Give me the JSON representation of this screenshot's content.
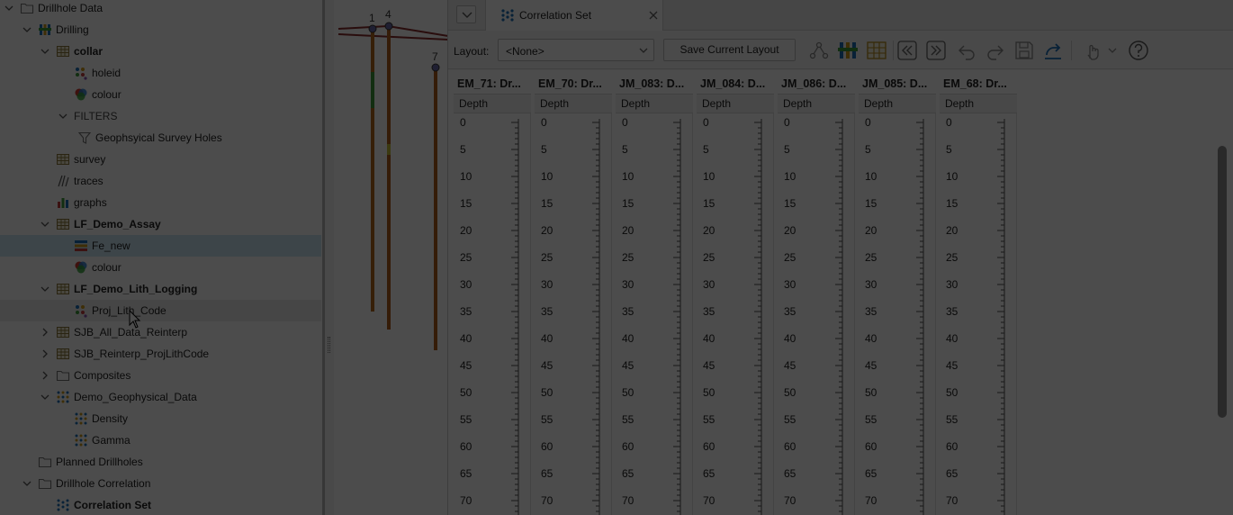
{
  "tree": {
    "rows": [
      {
        "label": "Drillhole Data",
        "expanded": true,
        "icon": "folder-icon",
        "bold": false
      },
      {
        "label": "Drilling",
        "expanded": true,
        "icon": "drillholes-icon",
        "bold": false
      },
      {
        "label": "collar",
        "expanded": true,
        "icon": "table-icon",
        "bold": true
      },
      {
        "label": "holeid",
        "expanded": null,
        "icon": "category-colour-icon",
        "bold": false
      },
      {
        "label": "colour",
        "expanded": null,
        "icon": "colour-icon",
        "bold": false
      },
      {
        "label": "FILTERS",
        "expanded": true,
        "icon": null,
        "bold": false
      },
      {
        "label": "Geophsyical Survey Holes",
        "expanded": null,
        "icon": "filter-icon",
        "bold": false
      },
      {
        "label": "survey",
        "expanded": null,
        "icon": "table-icon",
        "bold": false
      },
      {
        "label": "traces",
        "expanded": null,
        "icon": "traces-icon",
        "bold": false
      },
      {
        "label": "graphs",
        "expanded": null,
        "icon": "graphs-icon",
        "bold": false
      },
      {
        "label": "LF_Demo_Assay",
        "expanded": true,
        "icon": "table-icon",
        "bold": true
      },
      {
        "label": "Fe_new",
        "expanded": null,
        "icon": "numeric-colour-icon",
        "bold": false
      },
      {
        "label": "colour",
        "expanded": null,
        "icon": "colour-icon",
        "bold": false
      },
      {
        "label": "LF_Demo_Lith_Logging",
        "expanded": true,
        "icon": "table-icon",
        "bold": true
      },
      {
        "label": "Proj_Lith_Code",
        "expanded": null,
        "icon": "category-colour-icon",
        "bold": false
      },
      {
        "label": "SJB_All_Data_Reinterp",
        "expanded": false,
        "icon": "table-icon",
        "bold": false
      },
      {
        "label": "SJB_Reinterp_ProjLithCode",
        "expanded": false,
        "icon": "table-icon",
        "bold": false
      },
      {
        "label": "Composites",
        "expanded": false,
        "icon": "folder-icon",
        "bold": false
      },
      {
        "label": "Demo_Geophysical_Data",
        "expanded": true,
        "icon": "points-icon",
        "bold": false
      },
      {
        "label": "Density",
        "expanded": null,
        "icon": "points-icon",
        "bold": false
      },
      {
        "label": "Gamma",
        "expanded": null,
        "icon": "points-icon",
        "bold": false
      },
      {
        "label": "Planned Drillholes",
        "expanded": null,
        "icon": "folder-icon",
        "bold": false
      },
      {
        "label": "Drillhole Correlation",
        "expanded": true,
        "icon": "folder-icon",
        "bold": false
      },
      {
        "label": "Correlation Set",
        "expanded": null,
        "icon": "correlation-set-icon",
        "bold": true
      }
    ]
  },
  "scene": {
    "hole_labels": [
      "1",
      "4",
      "7"
    ]
  },
  "correlation": {
    "tab_title": "Correlation Set",
    "toolbar": {
      "layout_label": "Layout:",
      "layout_value": "<None>",
      "save_layout_label": "Save Current Layout"
    },
    "depth_header": "Depth",
    "columns": [
      "EM_71: Dr...",
      "EM_70: Dr...",
      "JM_083: D...",
      "JM_084: D...",
      "JM_086: D...",
      "JM_085: D...",
      "EM_68: Dr..."
    ],
    "depth_ticks": [
      "0",
      "5",
      "10",
      "15",
      "20",
      "25",
      "30",
      "35",
      "40",
      "45",
      "50",
      "55",
      "60",
      "65",
      "70"
    ]
  },
  "colors": {
    "selection": "#cde8f6",
    "accent_blue": "#1d6fb8",
    "overlay": "rgba(0,0,0,0.70)"
  }
}
